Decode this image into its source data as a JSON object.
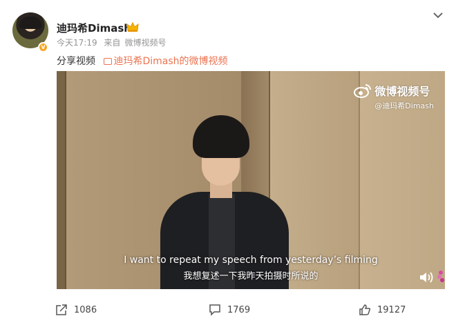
{
  "post": {
    "username": "迪玛希Dimash",
    "time": "今天17:19",
    "source_prefix": "来自",
    "source": "微博视频号",
    "share_text": "分享视频",
    "share_link": "迪玛希Dimash的微博视频"
  },
  "video": {
    "watermark_title": "微博视频号",
    "watermark_handle": "@迪玛希Dimash",
    "subtitle_en": "I want to repeat my speech from yesterday’s filming",
    "subtitle_zh": "我想复述一下我昨天拍摄时所说的"
  },
  "actions": {
    "share_count": "1086",
    "comment_count": "1769",
    "like_count": "19127"
  },
  "colors": {
    "link": "#eb7350",
    "verified": "#f6a623"
  },
  "icons": [
    "avatar",
    "verified-icon",
    "crown-icon",
    "chevron-down-icon",
    "link-icon",
    "weibo-logo-icon",
    "volume-icon",
    "share-icon",
    "comment-icon",
    "like-icon"
  ]
}
